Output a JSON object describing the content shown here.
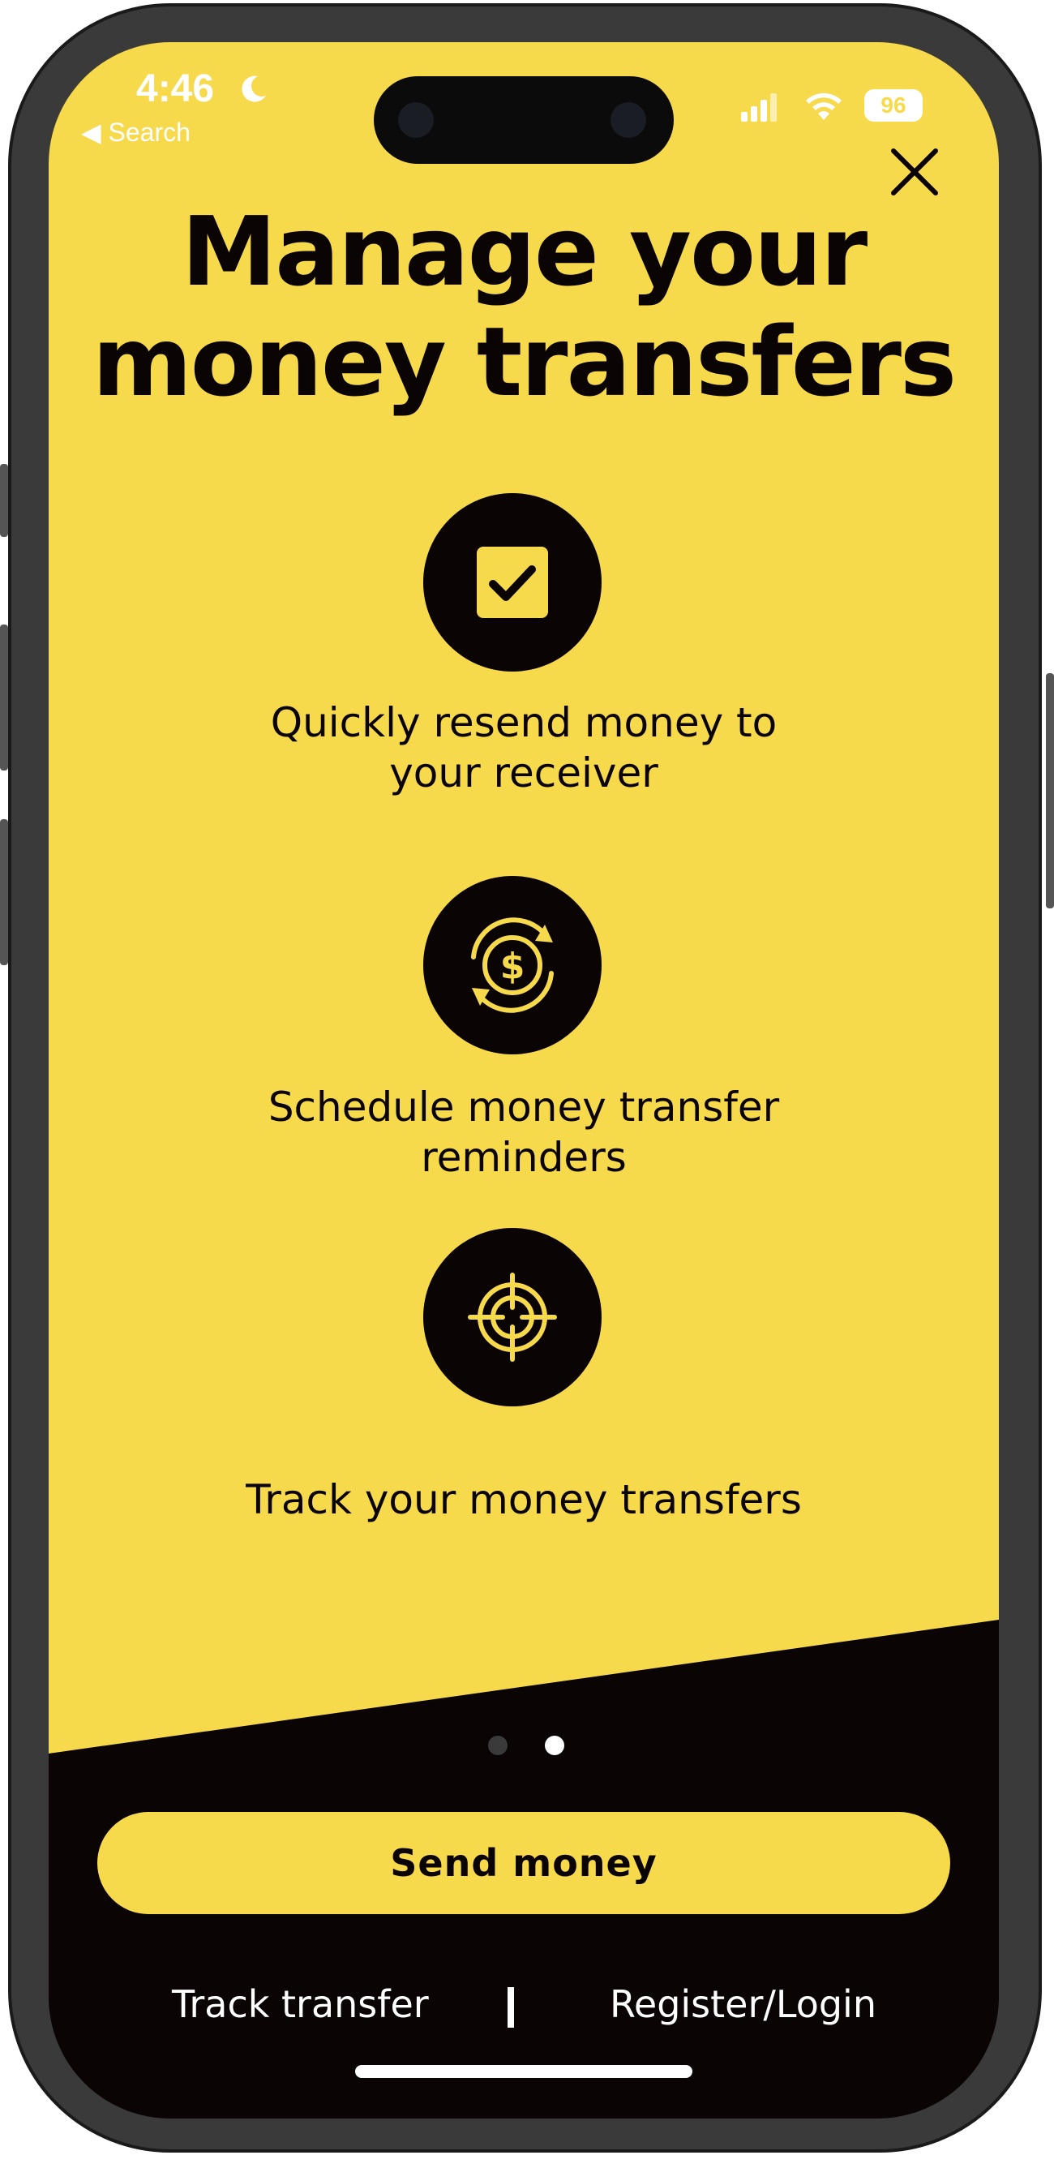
{
  "status_bar": {
    "time": "4:46",
    "back_label": "◀ Search",
    "battery": "96",
    "icons": [
      "moon-icon",
      "signal-icon",
      "wifi-icon",
      "battery-icon"
    ]
  },
  "header": {
    "title": "Manage your\nmoney transfers",
    "close_icon": "close-icon"
  },
  "features": [
    {
      "icon": "checkbox-icon",
      "text": "Quickly resend money to\nyour receiver"
    },
    {
      "icon": "dollar-refresh-icon",
      "text": "Schedule money transfer\nreminders"
    },
    {
      "icon": "target-icon",
      "text": "Track your money transfers"
    }
  ],
  "pager": {
    "total": 2,
    "active_index": 1
  },
  "actions": {
    "primary_label": "Send money",
    "track_label": "Track transfer",
    "separator": "|",
    "register_label": "Register/Login"
  },
  "colors": {
    "brand_yellow": "#f7da4c",
    "dark": "#0a0405",
    "white": "#ffffff"
  }
}
